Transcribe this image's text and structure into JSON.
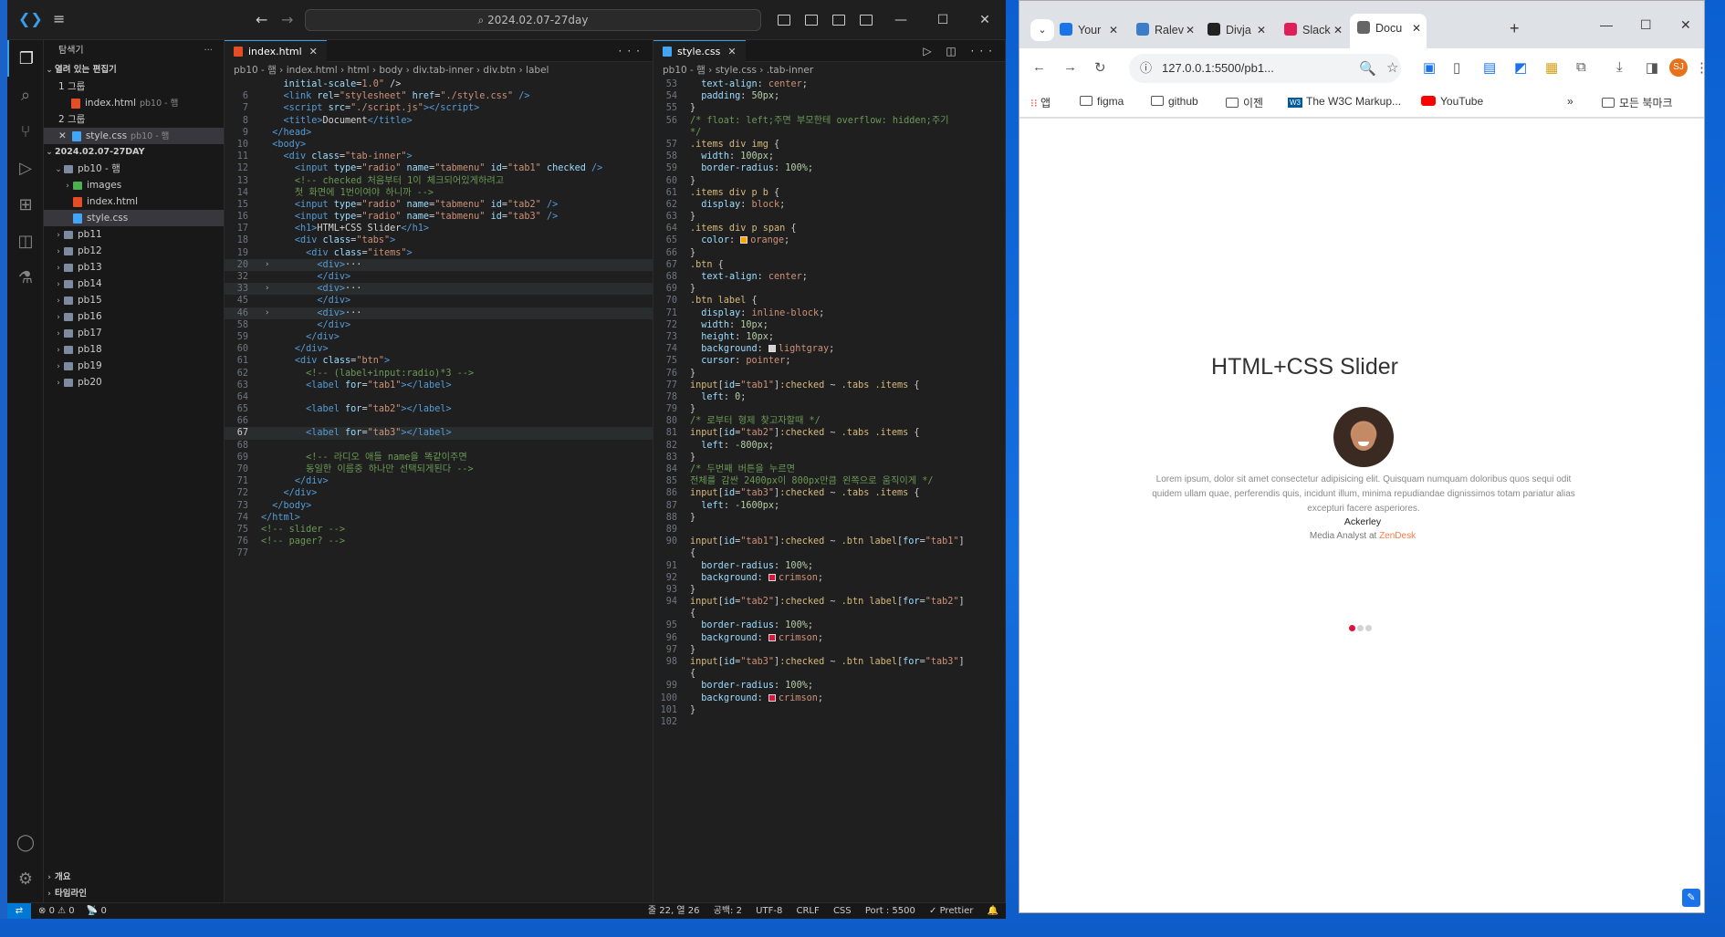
{
  "vscode": {
    "search": "2024.02.07-27day",
    "explorer_title": "탐색기",
    "sections": {
      "open_editors": "열려 있는 편집기",
      "group1": "1 그룹",
      "group2": "2 그룹",
      "workspace": "2024.02.07-27DAY",
      "outline": "개요",
      "timeline": "타임라인"
    },
    "open_editor_1": {
      "name": "index.html",
      "path": "pb10 - 햄"
    },
    "open_editor_2": {
      "name": "style.css",
      "path": "pb10 - 햄"
    },
    "tree": {
      "root": "pb10 - 햄",
      "images": "images",
      "index": "index.html",
      "style": "style.css",
      "folders": [
        "pb11",
        "pb12",
        "pb13",
        "pb14",
        "pb15",
        "pb16",
        "pb17",
        "pb18",
        "pb19",
        "pb20"
      ]
    },
    "left_tab": "index.html",
    "left_crumbs": [
      "pb10 - 햄",
      "index.html",
      "html",
      "body",
      "div.tab-inner",
      "div.btn",
      "label"
    ],
    "right_tab": "style.css",
    "right_crumbs": [
      "pb10 - 햄",
      "style.css",
      ".tab-inner"
    ],
    "status": {
      "problems": "0 ⚠ 0",
      "ports": "0",
      "cursor": "줄 22, 열 26",
      "spaces": "공백: 2",
      "encoding": "UTF-8",
      "eol": "CRLF",
      "lang": "CSS",
      "port": "Port : 5500",
      "prettier": "✓ Prettier"
    }
  },
  "chrome": {
    "tabs": [
      {
        "label": "Your",
        "color": "#1a73e8"
      },
      {
        "label": "Ralev",
        "color": "#3d7cc9"
      },
      {
        "label": "Divja",
        "color": "#222222"
      },
      {
        "label": "Slack",
        "color": "#e01e5a"
      },
      {
        "label": "Docu",
        "color": "#666666"
      }
    ],
    "url": "127.0.0.1:5500/pb1...",
    "profile": "SJ",
    "bookmarks": {
      "apps": "앱",
      "figma": "figma",
      "github": "github",
      "old": "이젠",
      "w3c": "The W3C Markup...",
      "youtube": "YouTube",
      "all": "모든 북마크"
    },
    "page": {
      "title": "HTML+CSS Slider",
      "body": "Lorem ipsum, dolor sit amet consectetur adipisicing elit. Quisquam numquam doloribus quos sequi odit quidem ullam quae, perferendis quis, incidunt illum, minima repudiandae dignissimos totam pariatur alias excepturi facere asperiores.",
      "name": "Ackerley",
      "role_prefix": "Media Analyst at",
      "company": "ZenDesk",
      "active_dot": 1,
      "accent": "#dc143c"
    }
  },
  "html_lines": [
    {
      "n": "",
      "h": "    <span class='t-attr'>initial-scale</span><span class='t-txt'>=</span><span class='t-str'>1.0\"</span><span class='t-txt'> /></span>"
    },
    {
      "n": "6",
      "h": "    <span class='t-tag'>&lt;link</span> <span class='t-attr'>rel</span>=<span class='t-str'>\"stylesheet\"</span> <span class='t-attr'>href</span>=<span class='t-str'>\"./style.css\"</span> <span class='t-tag'>/&gt;</span>"
    },
    {
      "n": "7",
      "h": "    <span class='t-tag'>&lt;script</span> <span class='t-attr'>src</span>=<span class='t-str'>\"./script.js\"</span><span class='t-tag'>&gt;&lt;/script&gt;</span>"
    },
    {
      "n": "8",
      "h": "    <span class='t-tag'>&lt;title&gt;</span><span class='t-txt'>Document</span><span class='t-tag'>&lt;/title&gt;</span>"
    },
    {
      "n": "9",
      "h": "  <span class='t-tag'>&lt;/head&gt;</span>"
    },
    {
      "n": "10",
      "h": "  <span class='t-tag'>&lt;body&gt;</span>"
    },
    {
      "n": "11",
      "h": "    <span class='t-tag'>&lt;div</span> <span class='t-attr'>class</span>=<span class='t-str'>\"tab-inner\"</span><span class='t-tag'>&gt;</span>"
    },
    {
      "n": "12",
      "h": "      <span class='t-tag'>&lt;input</span> <span class='t-attr'>type</span>=<span class='t-str'>\"radio\"</span> <span class='t-attr'>name</span>=<span class='t-str'>\"tabmenu\"</span> <span class='t-attr'>id</span>=<span class='t-str'>\"tab1\"</span> <span class='t-attr'>checked</span> <span class='t-tag'>/&gt;</span>"
    },
    {
      "n": "13",
      "h": "      <span class='t-com'>&lt;!-- checked 처음부터 1이 체크되어있게하려고</span>"
    },
    {
      "n": "14",
      "h": "      <span class='t-com'>첫 화면에 1번이여야 하니까 --&gt;</span>"
    },
    {
      "n": "15",
      "h": "      <span class='t-tag'>&lt;input</span> <span class='t-attr'>type</span>=<span class='t-str'>\"radio\"</span> <span class='t-attr'>name</span>=<span class='t-str'>\"tabmenu\"</span> <span class='t-attr'>id</span>=<span class='t-str'>\"tab2\"</span> <span class='t-tag'>/&gt;</span>"
    },
    {
      "n": "16",
      "h": "      <span class='t-tag'>&lt;input</span> <span class='t-attr'>type</span>=<span class='t-str'>\"radio\"</span> <span class='t-attr'>name</span>=<span class='t-str'>\"tabmenu\"</span> <span class='t-attr'>id</span>=<span class='t-str'>\"tab3\"</span> <span class='t-tag'>/&gt;</span>"
    },
    {
      "n": "17",
      "h": "      <span class='t-tag'>&lt;h1&gt;</span><span class='t-txt'>HTML+CSS Slider</span><span class='t-tag'>&lt;/h1&gt;</span>"
    },
    {
      "n": "18",
      "h": "      <span class='t-tag'>&lt;div</span> <span class='t-attr'>class</span>=<span class='t-str'>\"tabs\"</span><span class='t-tag'>&gt;</span>"
    },
    {
      "n": "19",
      "h": "        <span class='t-tag'>&lt;div</span> <span class='t-attr'>class</span>=<span class='t-str'>\"items\"</span><span class='t-tag'>&gt;</span>"
    },
    {
      "n": "20",
      "h": "          <span class='t-tag'>&lt;div&gt;</span><span class='t-txt'>···</span>",
      "f": true,
      "hl": true
    },
    {
      "n": "32",
      "h": "          <span class='t-tag'>&lt;/div&gt;</span>"
    },
    {
      "n": "33",
      "h": "          <span class='t-tag'>&lt;div&gt;</span><span class='t-txt'>···</span>",
      "f": true,
      "hl": true
    },
    {
      "n": "45",
      "h": "          <span class='t-tag'>&lt;/div&gt;</span>"
    },
    {
      "n": "46",
      "h": "          <span class='t-tag'>&lt;div&gt;</span><span class='t-txt'>···</span>",
      "f": true,
      "hl": true
    },
    {
      "n": "58",
      "h": "          <span class='t-tag'>&lt;/div&gt;</span>"
    },
    {
      "n": "59",
      "h": "        <span class='t-tag'>&lt;/div&gt;</span>"
    },
    {
      "n": "60",
      "h": "      <span class='t-tag'>&lt;/div&gt;</span>"
    },
    {
      "n": "61",
      "h": "      <span class='t-tag'>&lt;div</span> <span class='t-attr'>class</span>=<span class='t-str'>\"btn\"</span><span class='t-tag'>&gt;</span>"
    },
    {
      "n": "62",
      "h": "        <span class='t-com'>&lt;!-- (label+input:radio)*3 --&gt;</span>"
    },
    {
      "n": "63",
      "h": "        <span class='t-tag'>&lt;label</span> <span class='t-attr'>for</span>=<span class='t-str'>\"tab1\"</span><span class='t-tag'>&gt;&lt;/label&gt;</span>"
    },
    {
      "n": "64",
      "h": ""
    },
    {
      "n": "65",
      "h": "        <span class='t-tag'>&lt;label</span> <span class='t-attr'>for</span>=<span class='t-str'>\"tab2\"</span><span class='t-tag'>&gt;&lt;/label&gt;</span>"
    },
    {
      "n": "66",
      "h": ""
    },
    {
      "n": "67",
      "h": "        <span class='t-tag'>&lt;label</span> <span class='t-attr'>for</span>=<span class='t-str'>\"tab3\"</span><span class='t-tag'>&gt;&lt;/label&gt;</span>",
      "hl": true,
      "cur": true
    },
    {
      "n": "68",
      "h": ""
    },
    {
      "n": "69",
      "h": "        <span class='t-com'>&lt;!-- 라디오 애들 name을 똑같이주면</span>"
    },
    {
      "n": "70",
      "h": "        <span class='t-com'>동일한 이름중 하나만 선택되게된다 --&gt;</span>"
    },
    {
      "n": "71",
      "h": "      <span class='t-tag'>&lt;/div&gt;</span>"
    },
    {
      "n": "72",
      "h": "    <span class='t-tag'>&lt;/div&gt;</span>"
    },
    {
      "n": "73",
      "h": "  <span class='t-tag'>&lt;/body&gt;</span>"
    },
    {
      "n": "74",
      "h": "<span class='t-tag'>&lt;/html&gt;</span>"
    },
    {
      "n": "75",
      "h": "<span class='t-com'>&lt;!-- slider --&gt;</span>"
    },
    {
      "n": "76",
      "h": "<span class='t-com'>&lt;!-- pager? --&gt;</span>"
    },
    {
      "n": "77",
      "h": ""
    }
  ],
  "css_lines": [
    {
      "n": "53",
      "h": "  <span class='t-prop'>text-align</span>: <span class='t-val'>center</span>;"
    },
    {
      "n": "54",
      "h": "  <span class='t-prop'>padding</span>: <span class='t-num'>50px</span>;"
    },
    {
      "n": "55",
      "h": "<span class='t-kw'>}</span>"
    },
    {
      "n": "56",
      "h": "<span class='t-com'>/* float: left;주면 부모한테 overflow: hidden;주기</span>"
    },
    {
      "n": "",
      "h": "<span class='t-com'>*/</span>"
    },
    {
      "n": "57",
      "h": "<span class='t-sel'>.items div img</span> {"
    },
    {
      "n": "58",
      "h": "  <span class='t-prop'>width</span>: <span class='t-num'>100px</span>;"
    },
    {
      "n": "59",
      "h": "  <span class='t-prop'>border-radius</span>: <span class='t-num'>100%</span>;"
    },
    {
      "n": "60",
      "h": "}"
    },
    {
      "n": "61",
      "h": "<span class='t-sel'>.items div p b</span> {"
    },
    {
      "n": "62",
      "h": "  <span class='t-prop'>display</span>: <span class='t-val'>block</span>;"
    },
    {
      "n": "63",
      "h": "}"
    },
    {
      "n": "64",
      "h": "<span class='t-sel'>.items div p span</span> {"
    },
    {
      "n": "65",
      "h": "  <span class='t-prop'>color</span>: <span class='sw' style='background:orange'></span><span class='t-val'>orange</span>;"
    },
    {
      "n": "66",
      "h": "}"
    },
    {
      "n": "67",
      "h": "<span class='t-sel'>.btn</span> {"
    },
    {
      "n": "68",
      "h": "  <span class='t-prop'>text-align</span>: <span class='t-val'>center</span>;"
    },
    {
      "n": "69",
      "h": "}"
    },
    {
      "n": "70",
      "h": "<span class='t-sel'>.btn label</span> {"
    },
    {
      "n": "71",
      "h": "  <span class='t-prop'>display</span>: <span class='t-val'>inline-block</span>;"
    },
    {
      "n": "72",
      "h": "  <span class='t-prop'>width</span>: <span class='t-num'>10px</span>;"
    },
    {
      "n": "73",
      "h": "  <span class='t-prop'>height</span>: <span class='t-num'>10px</span>;"
    },
    {
      "n": "74",
      "h": "  <span class='t-prop'>background</span>: <span class='sw' style='background:lightgray'></span><span class='t-val'>lightgray</span>;"
    },
    {
      "n": "75",
      "h": "  <span class='t-prop'>cursor</span>: <span class='t-val'>pointer</span>;"
    },
    {
      "n": "76",
      "h": "}"
    },
    {
      "n": "77",
      "h": "<span class='t-sel'>input</span>[<span class='t-attr'>id</span>=<span class='t-str'>\"tab1\"</span>]<span class='t-sel'>:checked</span> ~ <span class='t-sel'>.tabs .items</span> {"
    },
    {
      "n": "78",
      "h": "  <span class='t-prop'>left</span>: <span class='t-num'>0</span>;"
    },
    {
      "n": "79",
      "h": "}"
    },
    {
      "n": "80",
      "h": "<span class='t-com'>/* 로부터 형제 찾고자할때 */</span>"
    },
    {
      "n": "81",
      "h": "<span class='t-sel'>input</span>[<span class='t-attr'>id</span>=<span class='t-str'>\"tab2\"</span>]<span class='t-sel'>:checked</span> ~ <span class='t-sel'>.tabs .items</span> {"
    },
    {
      "n": "82",
      "h": "  <span class='t-prop'>left</span>: <span class='t-num'>-800px</span>;"
    },
    {
      "n": "83",
      "h": "}"
    },
    {
      "n": "84",
      "h": "<span class='t-com'>/* 두번째 버튼을 누르면</span>"
    },
    {
      "n": "85",
      "h": "<span class='t-com'>전체를 감싼 2400px이 800px만큼 왼쪽으로 움직이게 */</span>"
    },
    {
      "n": "86",
      "h": "<span class='t-sel'>input</span>[<span class='t-attr'>id</span>=<span class='t-str'>\"tab3\"</span>]<span class='t-sel'>:checked</span> ~ <span class='t-sel'>.tabs .items</span> {"
    },
    {
      "n": "87",
      "h": "  <span class='t-prop'>left</span>: <span class='t-num'>-1600px</span>;"
    },
    {
      "n": "88",
      "h": "}"
    },
    {
      "n": "89",
      "h": ""
    },
    {
      "n": "90",
      "h": "<span class='t-sel'>input</span>[<span class='t-attr'>id</span>=<span class='t-str'>\"tab1\"</span>]<span class='t-sel'>:checked</span> ~ <span class='t-sel'>.btn label</span>[<span class='t-attr'>for</span>=<span class='t-str'>\"tab1\"</span>]"
    },
    {
      "n": "",
      "h": "{"
    },
    {
      "n": "91",
      "h": "  <span class='t-prop'>border-radius</span>: <span class='t-num'>100%</span>;"
    },
    {
      "n": "92",
      "h": "  <span class='t-prop'>background</span>: <span class='sw' style='background:crimson'></span><span class='t-val'>crimson</span>;"
    },
    {
      "n": "93",
      "h": "}"
    },
    {
      "n": "94",
      "h": "<span class='t-sel'>input</span>[<span class='t-attr'>id</span>=<span class='t-str'>\"tab2\"</span>]<span class='t-sel'>:checked</span> ~ <span class='t-sel'>.btn label</span>[<span class='t-attr'>for</span>=<span class='t-str'>\"tab2\"</span>]"
    },
    {
      "n": "",
      "h": "{"
    },
    {
      "n": "95",
      "h": "  <span class='t-prop'>border-radius</span>: <span class='t-num'>100%</span>;"
    },
    {
      "n": "96",
      "h": "  <span class='t-prop'>background</span>: <span class='sw' style='background:crimson'></span><span class='t-val'>crimson</span>;"
    },
    {
      "n": "97",
      "h": "}"
    },
    {
      "n": "98",
      "h": "<span class='t-sel'>input</span>[<span class='t-attr'>id</span>=<span class='t-str'>\"tab3\"</span>]<span class='t-sel'>:checked</span> ~ <span class='t-sel'>.btn label</span>[<span class='t-attr'>for</span>=<span class='t-str'>\"tab3\"</span>]"
    },
    {
      "n": "",
      "h": "{"
    },
    {
      "n": "99",
      "h": "  <span class='t-prop'>border-radius</span>: <span class='t-num'>100%</span>;"
    },
    {
      "n": "100",
      "h": "  <span class='t-prop'>background</span>: <span class='sw' style='background:crimson'></span><span class='t-val'>crimson</span>;"
    },
    {
      "n": "101",
      "h": "}"
    },
    {
      "n": "102",
      "h": ""
    }
  ]
}
